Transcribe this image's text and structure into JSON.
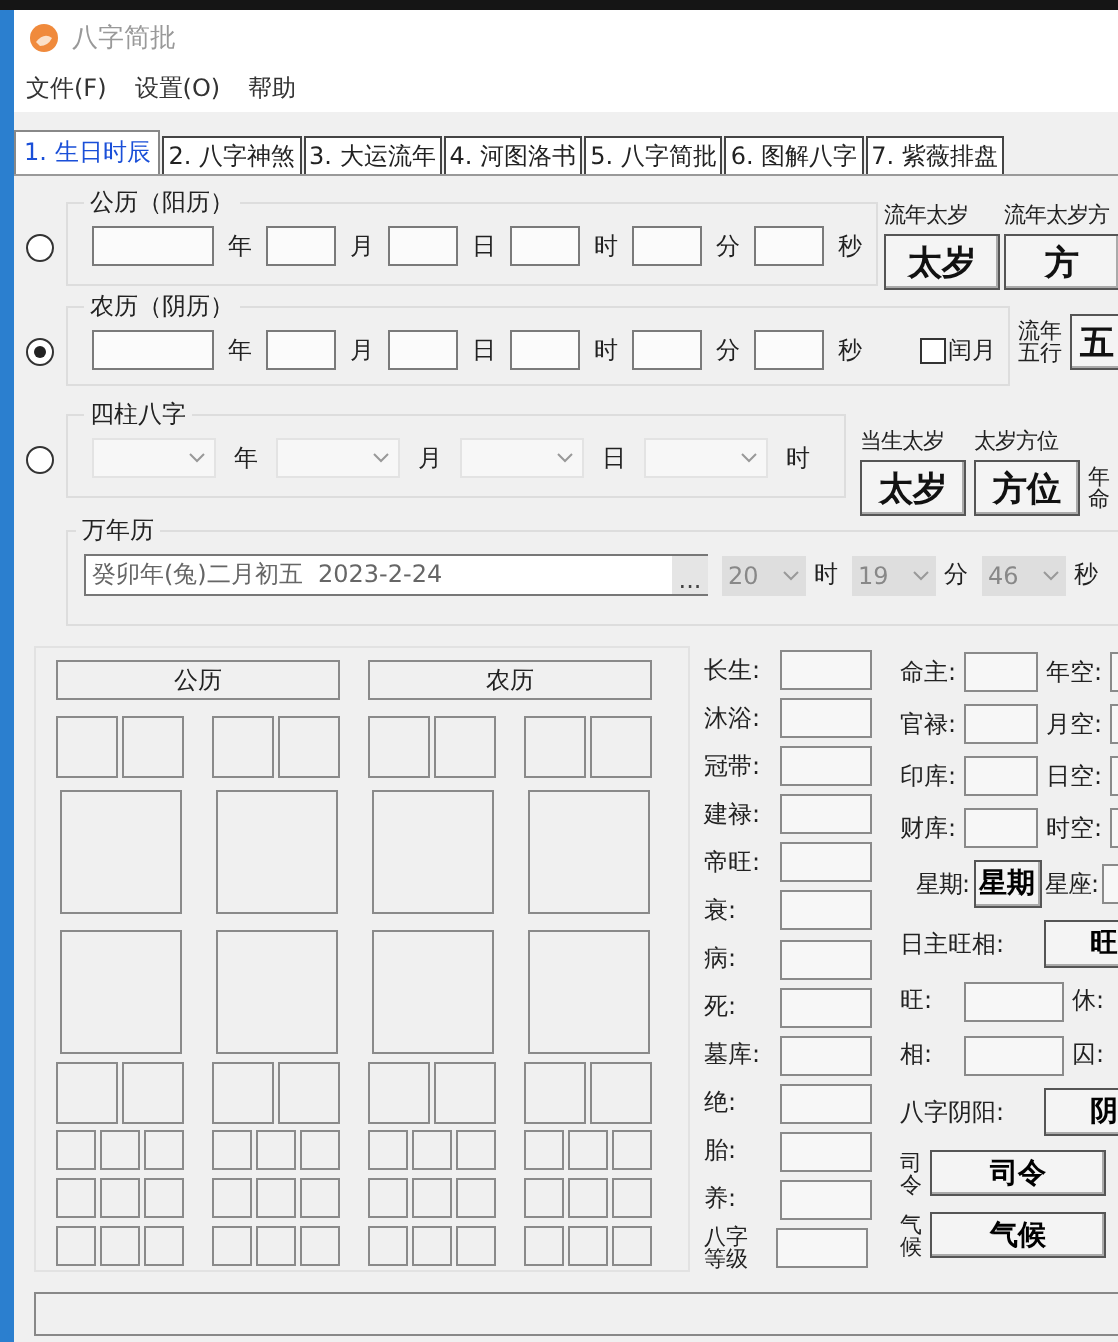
{
  "window": {
    "title": "八字简批"
  },
  "menu": [
    "文件(F)",
    "设置(O)",
    "帮助"
  ],
  "tabs": [
    {
      "label": "1. 生日时辰",
      "selected": true
    },
    {
      "label": "2. 八字神煞",
      "selected": false
    },
    {
      "label": "3. 大运流年",
      "selected": false
    },
    {
      "label": "4. 河图洛书",
      "selected": false
    },
    {
      "label": "5. 八字简批",
      "selected": false
    },
    {
      "label": "6. 图解八字",
      "selected": false
    },
    {
      "label": "7. 紫薇排盘",
      "selected": false
    }
  ],
  "input_rows": [
    {
      "kind": "fields",
      "title": "公历（阳历）",
      "selected": false,
      "units": [
        "年",
        "月",
        "日",
        "时",
        "分",
        "秒"
      ],
      "side": [
        {
          "kind": "stacked",
          "label": "流年太岁",
          "button": "太岁"
        },
        {
          "kind": "stacked",
          "label": "流年太岁方",
          "button": "方"
        }
      ]
    },
    {
      "kind": "fields",
      "title": "农历（阴历）",
      "selected": true,
      "units": [
        "年",
        "月",
        "日",
        "时",
        "分",
        "秒"
      ],
      "leap_month": {
        "label": "闰月",
        "checked": false
      },
      "side": [
        {
          "kind": "vertical",
          "label": "流年五行",
          "button": "五"
        }
      ]
    },
    {
      "kind": "combos",
      "title": "四柱八字",
      "selected": false,
      "units": [
        "年",
        "月",
        "日",
        "时"
      ],
      "side": [
        {
          "kind": "stacked",
          "label": "当生太岁",
          "button": "太岁"
        },
        {
          "kind": "stacked",
          "label": "太岁方位",
          "button": "方位"
        },
        {
          "kind": "vertical",
          "label": "年命"
        }
      ]
    }
  ],
  "calendar": {
    "title": "万年历",
    "value": "癸卯年(兔)二月初五  2023-2-24",
    "browse": "...",
    "time": [
      {
        "value": "20",
        "unit": "时"
      },
      {
        "value": "19",
        "unit": "分"
      },
      {
        "value": "46",
        "unit": "秒"
      }
    ]
  },
  "chart_headers": [
    "公历",
    "农历"
  ],
  "stages": [
    "长生:",
    "沐浴:",
    "冠带:",
    "建禄:",
    "帝旺:",
    "衰:",
    "病:",
    "死:",
    "墓库:",
    "绝:",
    "胎:",
    "养:",
    "八字等级"
  ],
  "info_rows": [
    {
      "kind": "pair",
      "cells": [
        {
          "kind": "label",
          "text": "命主:"
        },
        {
          "kind": "field"
        },
        {
          "kind": "label",
          "text": "年空:"
        },
        {
          "kind": "field"
        }
      ]
    },
    {
      "kind": "pair",
      "cells": [
        {
          "kind": "label",
          "text": "官禄:"
        },
        {
          "kind": "field"
        },
        {
          "kind": "label",
          "text": "月空:"
        },
        {
          "kind": "field"
        }
      ]
    },
    {
      "kind": "pair",
      "cells": [
        {
          "kind": "label",
          "text": "印库:"
        },
        {
          "kind": "field"
        },
        {
          "kind": "label",
          "text": "日空:"
        },
        {
          "kind": "field"
        }
      ]
    },
    {
      "kind": "pair",
      "cells": [
        {
          "kind": "label",
          "text": "财库:"
        },
        {
          "kind": "field"
        },
        {
          "kind": "label",
          "text": "时空:"
        },
        {
          "kind": "field"
        }
      ]
    },
    {
      "kind": "week",
      "cells": [
        {
          "kind": "label",
          "text": "星期:"
        },
        {
          "kind": "button",
          "text": "星期"
        },
        {
          "kind": "label",
          "text": "星座:"
        },
        {
          "kind": "field"
        }
      ]
    },
    {
      "kind": "wide",
      "cells": [
        {
          "kind": "label",
          "text": "日主旺相:"
        },
        {
          "kind": "button",
          "text": "旺"
        }
      ]
    },
    {
      "kind": "pair_wide",
      "cells": [
        {
          "kind": "label",
          "text": "旺:"
        },
        {
          "kind": "field"
        },
        {
          "kind": "label",
          "text": "休:"
        },
        {
          "kind": "field"
        }
      ]
    },
    {
      "kind": "pair_wide",
      "cells": [
        {
          "kind": "label",
          "text": "相:"
        },
        {
          "kind": "field"
        },
        {
          "kind": "label",
          "text": "囚:"
        },
        {
          "kind": "field"
        }
      ]
    },
    {
      "kind": "wide",
      "cells": [
        {
          "kind": "label",
          "text": "八字阴阳:"
        },
        {
          "kind": "button",
          "text": "阴"
        }
      ]
    },
    {
      "kind": "vertical",
      "cells": [
        {
          "kind": "vlabel",
          "text": "司令"
        },
        {
          "kind": "button",
          "text": "司令"
        }
      ]
    },
    {
      "kind": "vertical",
      "cells": [
        {
          "kind": "vlabel",
          "text": "气候"
        },
        {
          "kind": "button",
          "text": "气候"
        }
      ]
    }
  ]
}
